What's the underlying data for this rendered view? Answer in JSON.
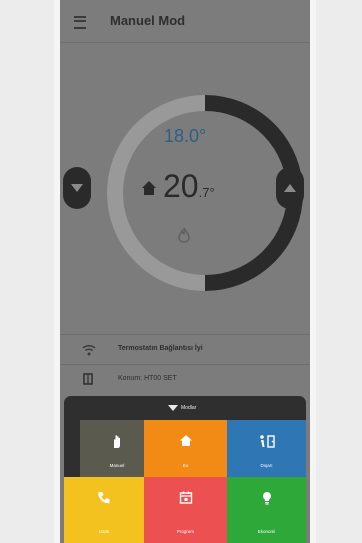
{
  "appbar": {
    "title": "Manuel Mod"
  },
  "thermostat": {
    "target_temp": "18.0°",
    "current_temp_int": "20",
    "current_temp_dec": ".7",
    "degree": "°"
  },
  "status": [
    {
      "icon": "wifi-icon",
      "text": "Termostatın Bağlantısı İyi"
    },
    {
      "icon": "device-icon",
      "text": "Konum: HT00 SET"
    }
  ],
  "mode_panel": {
    "header_label": "Modlar",
    "tiles": [
      {
        "label": "Manuel",
        "icon": "hand-icon",
        "color": "#5a5a4e"
      },
      {
        "label": "Ev",
        "icon": "home-icon",
        "color": "#f28a16"
      },
      {
        "label": "Dışarı",
        "icon": "away-icon",
        "color": "#2f77b4"
      },
      {
        "label": "Uzak",
        "icon": "phone-icon",
        "color": "#f4c21f"
      },
      {
        "label": "Program",
        "icon": "calendar-icon",
        "color": "#ec5051"
      },
      {
        "label": "Ekonomi",
        "icon": "bulb-icon",
        "color": "#2fa83a"
      }
    ]
  },
  "colors": {
    "overlay_bg": "#7c7c7c",
    "dial_arc": "#2a2a2a",
    "dial_track": "#999999",
    "target_text": "#2d5f85"
  }
}
